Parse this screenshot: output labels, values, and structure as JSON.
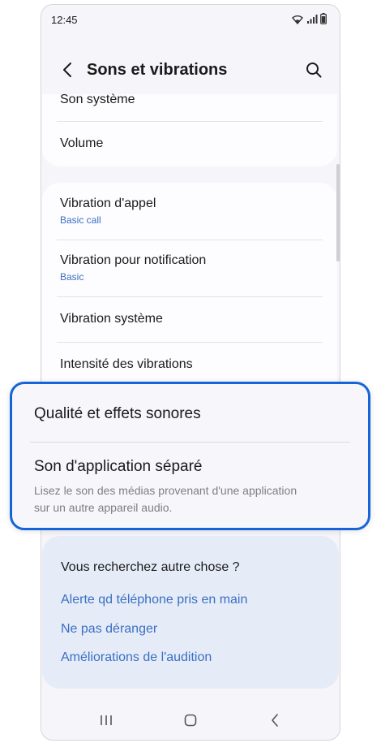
{
  "status_bar": {
    "time": "12:45"
  },
  "header": {
    "title": "Sons et vibrations"
  },
  "section1": {
    "items": [
      {
        "title": "Son système"
      },
      {
        "title": "Volume"
      }
    ]
  },
  "section2": {
    "items": [
      {
        "title": "Vibration d'appel",
        "subtitle": "Basic call"
      },
      {
        "title": "Vibration pour notification",
        "subtitle": "Basic"
      },
      {
        "title": "Vibration système"
      },
      {
        "title": "Intensité des vibrations"
      }
    ]
  },
  "highlight": {
    "items": [
      {
        "title": "Qualité et effets sonores"
      },
      {
        "title": "Son d'application séparé",
        "description_line1": "Lisez le son des médias provenant d'une application",
        "description_line2": "sur un autre appareil audio."
      }
    ]
  },
  "suggestions": {
    "title": "Vous recherchez autre chose ?",
    "links": [
      "Alerte qd téléphone pris en main",
      "Ne pas déranger",
      "Améliorations de l'audition"
    ]
  },
  "colors": {
    "accent": "#1565d8",
    "link": "#3a6fc4",
    "background": "#f6f5f9",
    "suggest_bg": "#e6ecf7"
  },
  "icons": {
    "back": "chevron-left-icon",
    "search": "search-icon",
    "wifi": "wifi-icon",
    "signal": "signal-icon",
    "battery": "battery-icon",
    "recents": "recents-icon",
    "home": "home-icon",
    "nav_back": "nav-back-icon"
  }
}
